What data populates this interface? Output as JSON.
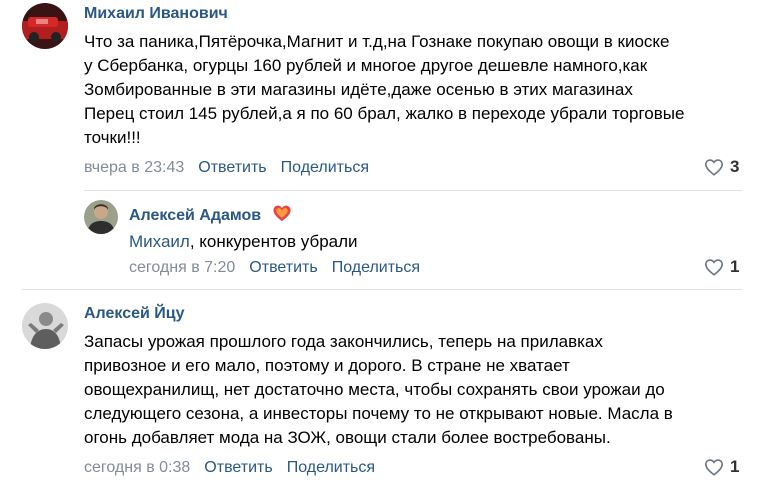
{
  "comments": [
    {
      "author": "Михаил Иванович",
      "text_lines": [
        "Что за паника,Пятёрочка,Магнит и т.д,на Гознаке покупаю овощи в киоске",
        "у Сбербанка, огурцы 160 рублей и многое другое дешевле намного,как",
        "Зомбированные в эти магазины идёте,даже осенью в этих магазинах",
        "Перец стоил 145 рублей,а я по 60 брал, жалко в переходе убрали торговые",
        "точки!!!"
      ],
      "timestamp": "вчера в 23:43",
      "reply_label": "Ответить",
      "share_label": "Поделиться",
      "likes": "3",
      "reply": {
        "author": "Алексей Адамов",
        "mention": "Михаил",
        "text_rest": ", конкурентов убрали",
        "timestamp": "сегодня в 7:20",
        "reply_label": "Ответить",
        "share_label": "Поделиться",
        "likes": "1",
        "badge_icon": "heart-badge-icon"
      }
    },
    {
      "author": "Алексей Йцу",
      "text_lines": [
        "Запасы урожая прошлого года закончились, теперь на прилавках",
        "привозное и его мало, поэтому и дорого. В стране не хватает",
        "овощехранилищ, нет достаточно места, чтобы сохранять свои урожаи до",
        "следующего сезона, а инвесторы почему то не открывают новые. Масла в",
        "огонь добавляет мода на ЗОЖ, овощи стали более востребованы."
      ],
      "timestamp": "сегодня в 0:38",
      "reply_label": "Ответить",
      "share_label": "Поделиться",
      "likes": "1"
    }
  ],
  "colors": {
    "link": "#2a5885",
    "meta": "#818c99",
    "divider": "#e1e3e6",
    "badge": "#e64646"
  }
}
